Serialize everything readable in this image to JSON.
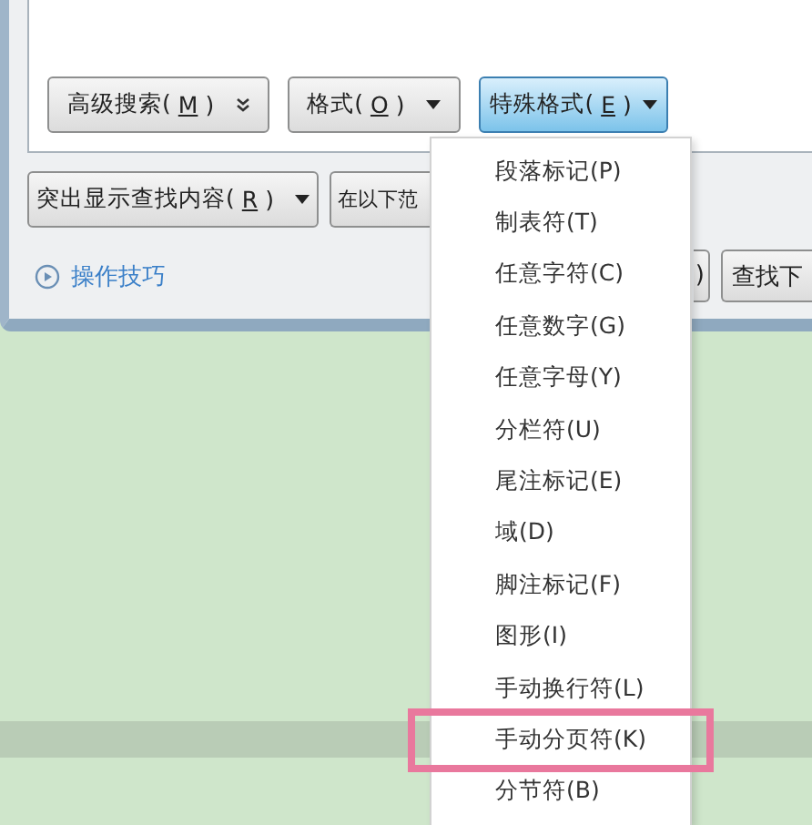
{
  "dialog": {
    "format_buttons": [
      {
        "text": "高级搜索(",
        "mnemonic": "M",
        "after": ")",
        "kind": "double",
        "pressed": false
      },
      {
        "text": "格式(",
        "mnemonic": "O",
        "after": ")",
        "kind": "single",
        "pressed": false
      },
      {
        "text": "特殊格式(",
        "mnemonic": "E",
        "after": ")",
        "kind": "single",
        "pressed": true
      }
    ],
    "option_buttons": [
      {
        "text": "突出显示查找内容(",
        "mnemonic": "R",
        "after": ")",
        "kind": "single"
      },
      {
        "text": "在以下范",
        "kind": "plain"
      }
    ],
    "tips_link": "操作技巧",
    "action_buttons": [
      ")",
      "查找下"
    ]
  },
  "menu": {
    "items": [
      {
        "label": "段落标记(P)",
        "highlighted": false
      },
      {
        "label": "制表符(T)",
        "highlighted": false
      },
      {
        "label": "任意字符(C)",
        "highlighted": false
      },
      {
        "label": "任意数字(G)",
        "highlighted": false
      },
      {
        "label": "任意字母(Y)",
        "highlighted": false
      },
      {
        "label": "分栏符(U)",
        "highlighted": false
      },
      {
        "label": "尾注标记(E)",
        "highlighted": false
      },
      {
        "label": "域(D)",
        "highlighted": false
      },
      {
        "label": "脚注标记(F)",
        "highlighted": false
      },
      {
        "label": "图形(I)",
        "highlighted": false
      },
      {
        "label": "手动换行符(L)",
        "highlighted": false
      },
      {
        "label": "手动分页符(K)",
        "highlighted": true
      },
      {
        "label": "分节符(B)",
        "highlighted": false
      }
    ]
  }
}
